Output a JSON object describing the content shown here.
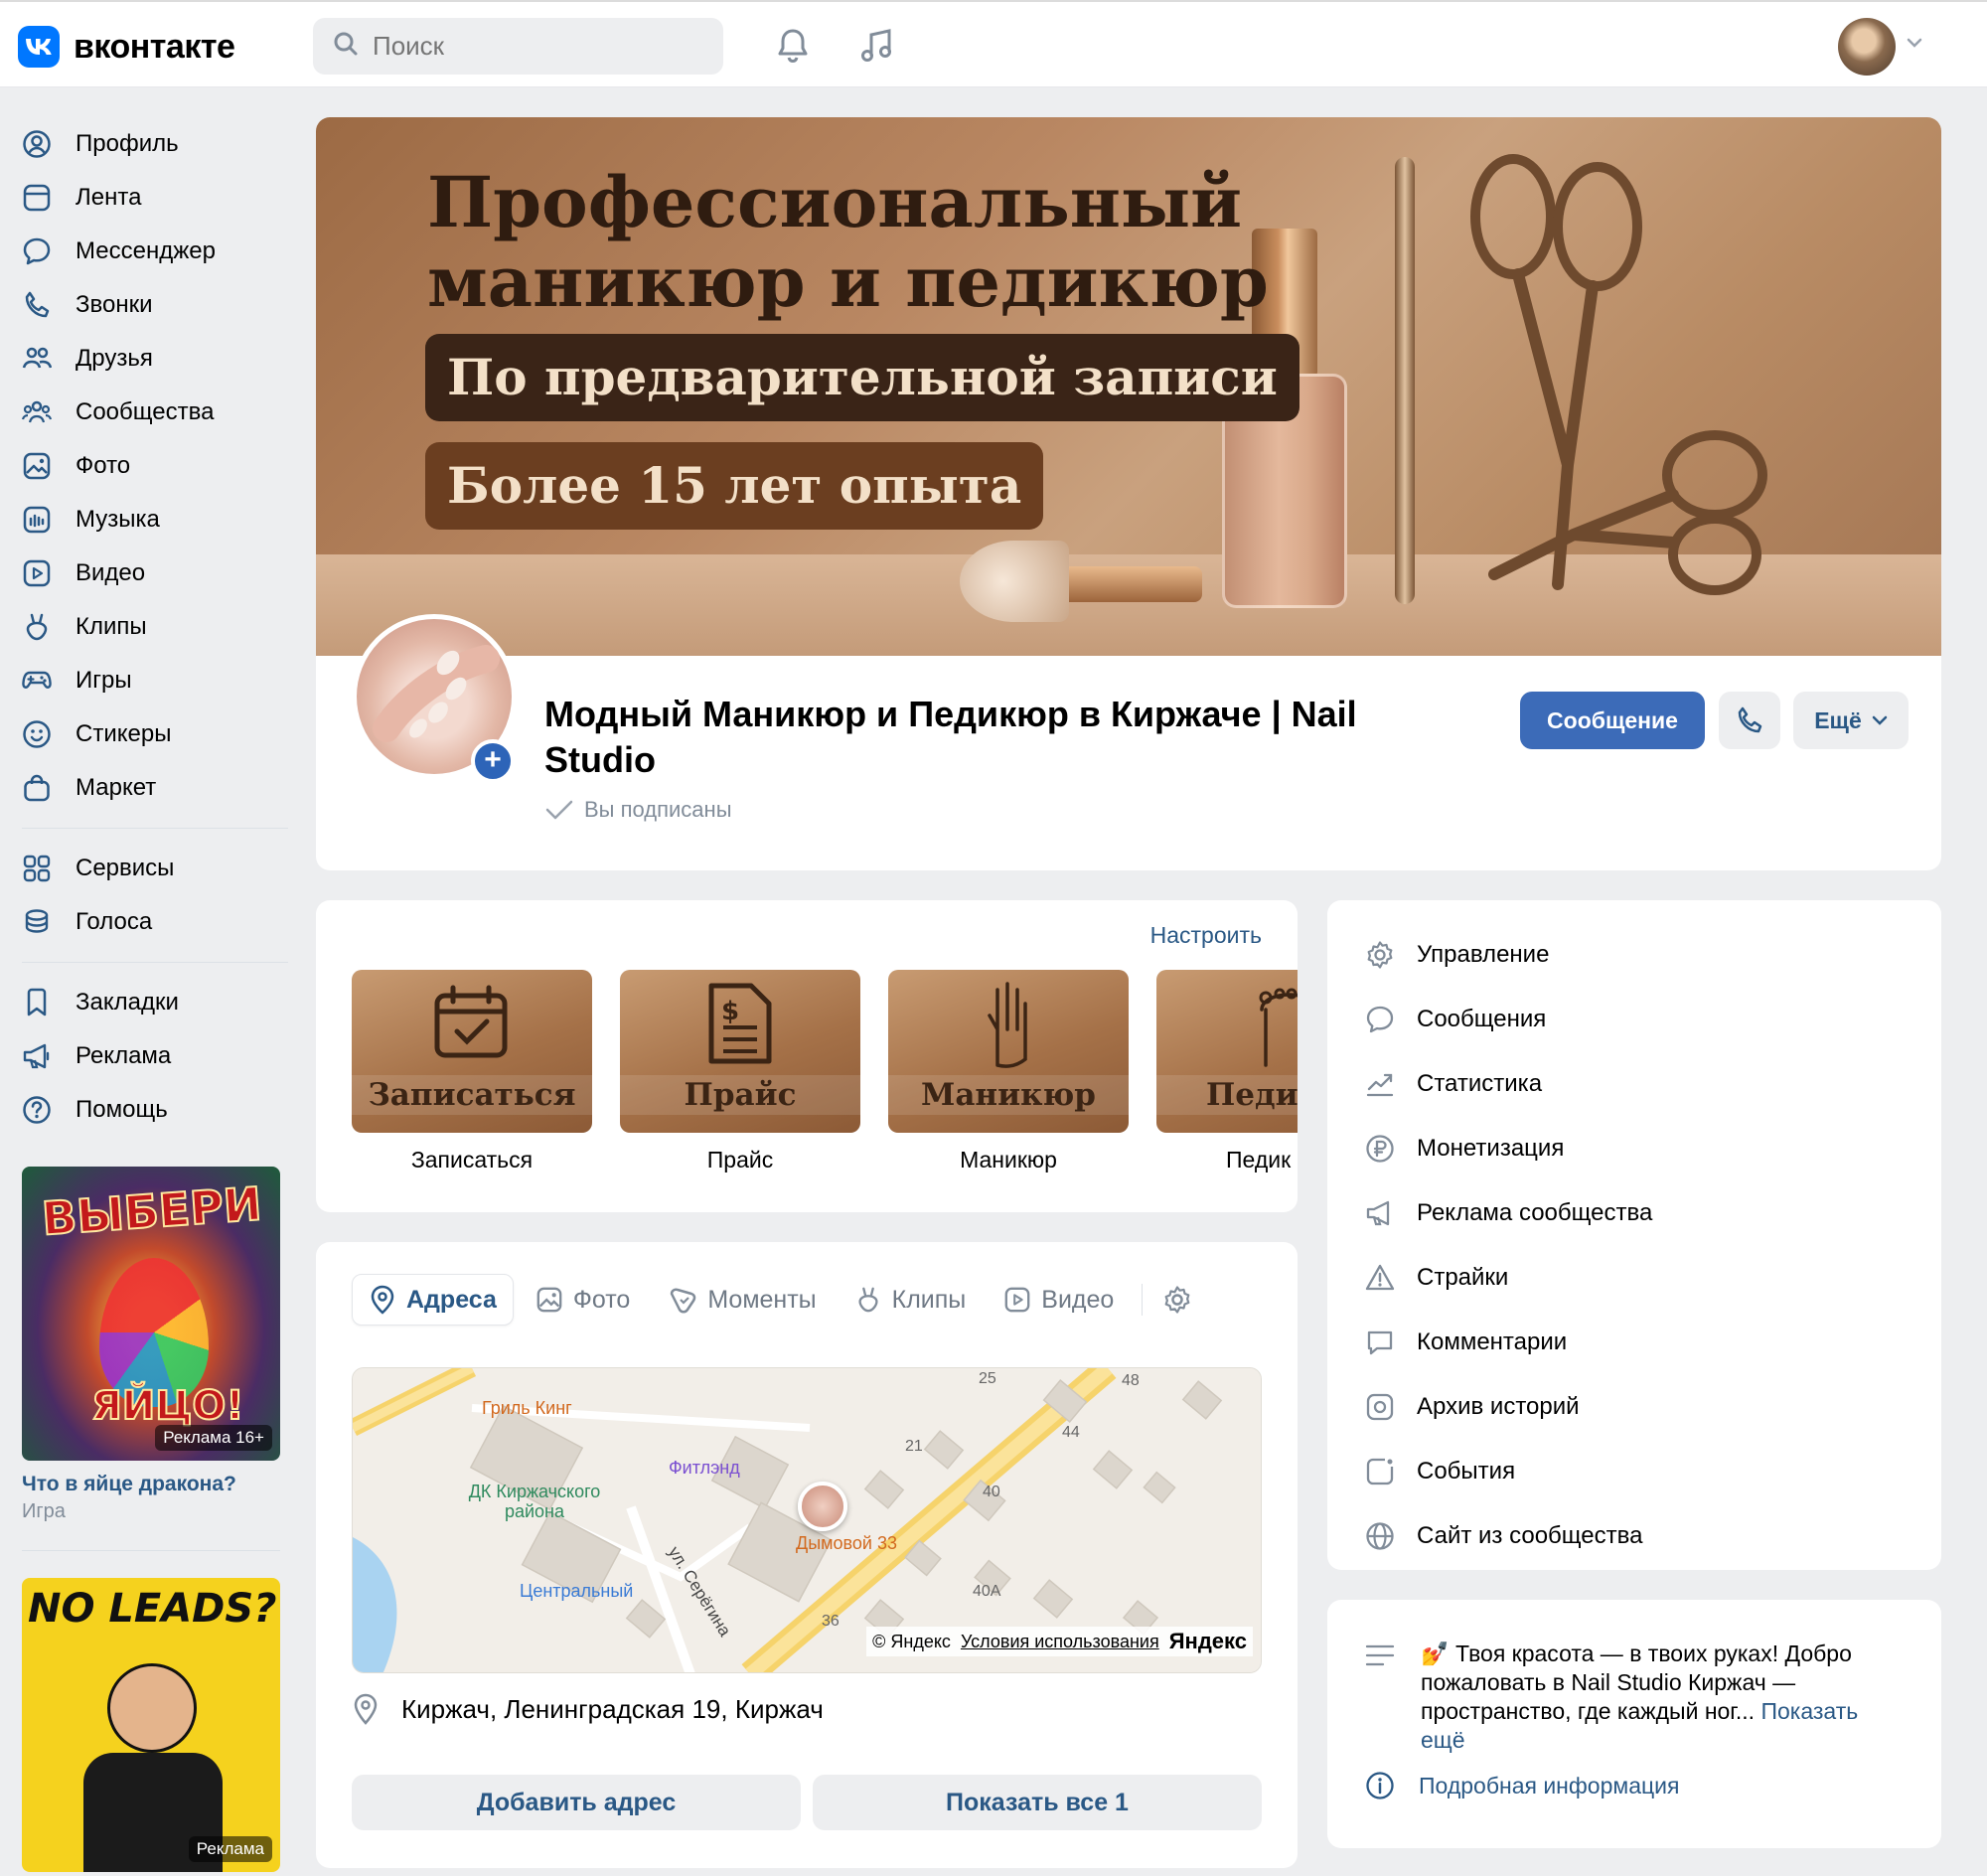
{
  "header": {
    "logo_text": "вконтакте",
    "search_placeholder": "Поиск"
  },
  "sidebar": {
    "items": [
      {
        "label": "Профиль",
        "icon": "user-circle-icon"
      },
      {
        "label": "Лента",
        "icon": "feed-icon"
      },
      {
        "label": "Мессенджер",
        "icon": "message-icon"
      },
      {
        "label": "Звонки",
        "icon": "phone-icon"
      },
      {
        "label": "Друзья",
        "icon": "friends-icon"
      },
      {
        "label": "Сообщества",
        "icon": "communities-icon"
      },
      {
        "label": "Фото",
        "icon": "photo-icon"
      },
      {
        "label": "Музыка",
        "icon": "music-icon"
      },
      {
        "label": "Видео",
        "icon": "video-icon"
      },
      {
        "label": "Клипы",
        "icon": "clips-icon"
      },
      {
        "label": "Игры",
        "icon": "gamepad-icon"
      },
      {
        "label": "Стикеры",
        "icon": "smile-icon"
      },
      {
        "label": "Маркет",
        "icon": "bag-icon"
      }
    ],
    "items2": [
      {
        "label": "Сервисы",
        "icon": "grid-icon"
      },
      {
        "label": "Голоса",
        "icon": "coins-icon"
      }
    ],
    "items3": [
      {
        "label": "Закладки",
        "icon": "bookmark-icon"
      },
      {
        "label": "Реклама",
        "icon": "megaphone-icon"
      },
      {
        "label": "Помощь",
        "icon": "help-icon"
      }
    ]
  },
  "ads": [
    {
      "image_text_top": "ВЫБЕРИ",
      "image_text_bottom": "ЯЙЦО!",
      "badge": "Реклама 16+",
      "title": "Что в яйце дракона?",
      "subtitle": "Игра"
    },
    {
      "image_text_top": "NO LEADS?",
      "badge": "Реклама"
    }
  ],
  "cover": {
    "title_line1": "Профессиональный",
    "title_line2": "маникюр и педикюр",
    "pill1": "По предварительной записи",
    "pill2": "Более 15 лет опыта"
  },
  "group": {
    "name": "Модный Маникюр и Педикюр в Киржаче | Nail Studio",
    "status": "Вы подписаны",
    "message_button": "Сообщение",
    "more_button": "Ещё"
  },
  "apps": {
    "configure": "Настроить",
    "items": [
      {
        "image_label": "Записаться",
        "label": "Записаться"
      },
      {
        "image_label": "Прайс",
        "label": "Прайс"
      },
      {
        "image_label": "Маникюр",
        "label": "Маникюр"
      },
      {
        "image_label": "Педик",
        "label": "Педик"
      }
    ]
  },
  "tabs": {
    "items": [
      "Адреса",
      "Фото",
      "Моменты",
      "Клипы",
      "Видео"
    ],
    "active": "Адреса"
  },
  "map": {
    "places": [
      "Гриль Кинг",
      "Фитлэнд",
      "ДК Киржачского района",
      "Центральный",
      "Дымовой 33",
      "ул. Серёгина"
    ],
    "numbers": [
      "25",
      "48",
      "44",
      "21",
      "40",
      "40А",
      "36"
    ],
    "copyright": "© Яндекс",
    "terms": "Условия использования",
    "brand": "Яндекс"
  },
  "address": {
    "text": "Киржач, Ленинградская 19, Киржач",
    "add_button": "Добавить адрес",
    "show_all_button": "Показать все 1"
  },
  "manage": {
    "items": [
      {
        "label": "Управление",
        "icon": "gear-icon"
      },
      {
        "label": "Сообщения",
        "icon": "message-icon"
      },
      {
        "label": "Статистика",
        "icon": "stats-icon"
      },
      {
        "label": "Монетизация",
        "icon": "ruble-icon"
      },
      {
        "label": "Реклама сообщества",
        "icon": "megaphone-icon"
      },
      {
        "label": "Страйки",
        "icon": "warning-icon"
      },
      {
        "label": "Комментарии",
        "icon": "comment-icon"
      },
      {
        "label": "Архив историй",
        "icon": "archive-icon"
      },
      {
        "label": "События",
        "icon": "event-icon"
      },
      {
        "label": "Сайт из сообщества",
        "icon": "globe-icon"
      }
    ]
  },
  "description": {
    "text": "💅 Твоя красота — в твоих руках! Добро пожаловать в Nail Studio Киржач — пространство, где каждый ног...",
    "more": "Показать ещё",
    "info_link": "Подробная информация"
  },
  "colors": {
    "accent": "#2a5885",
    "primary_button": "#3c6bb8",
    "vk_blue": "#0077ff",
    "background": "#edeef0"
  }
}
